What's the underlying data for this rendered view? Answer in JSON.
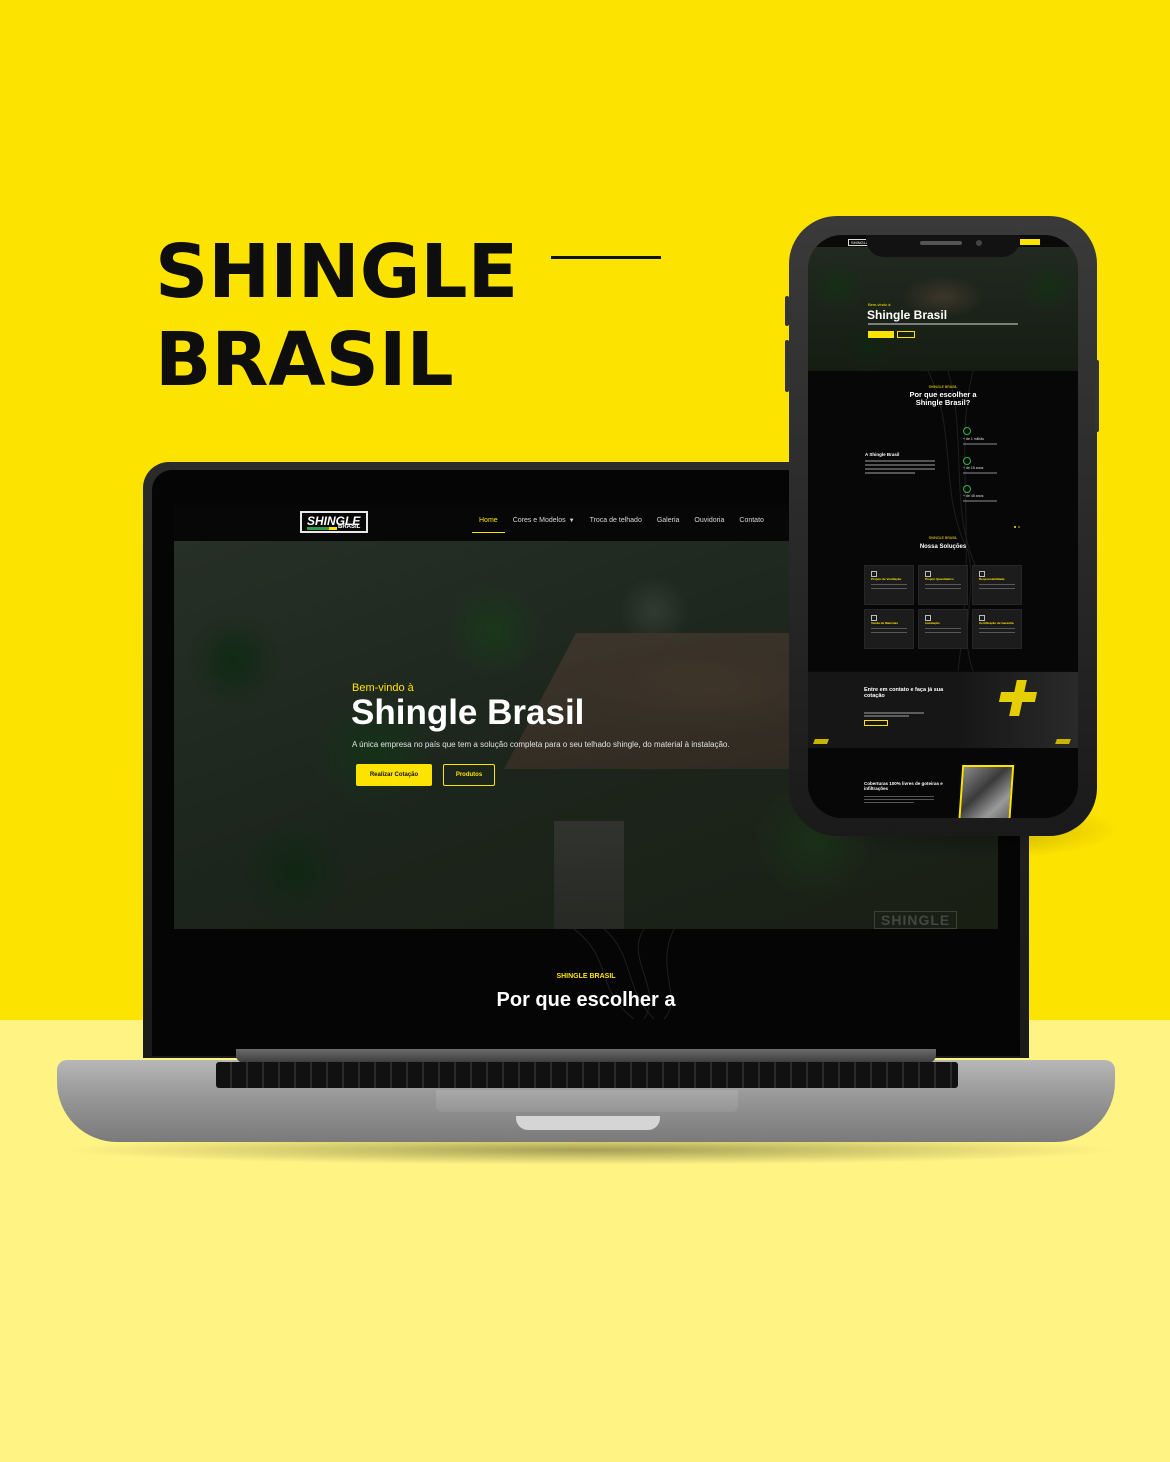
{
  "headline": {
    "line1": "SHINGLE",
    "line2": "BRASIL"
  },
  "colors": {
    "brand_yellow": "#fde300",
    "dark": "#0b0b0b",
    "accent_green": "#2e9a45"
  },
  "desktop": {
    "logo": {
      "main": "SHINGLE",
      "sub": "BRASIL"
    },
    "nav": [
      {
        "label": "Home",
        "active": true
      },
      {
        "label": "Cores e Modelos",
        "dropdown": true
      },
      {
        "label": "Troca de telhado"
      },
      {
        "label": "Galeria"
      },
      {
        "label": "Ouvidoria"
      },
      {
        "label": "Contato"
      }
    ],
    "hero": {
      "pre": "Bem-vindo à",
      "title": "Shingle Brasil",
      "desc": "A única empresa no país que tem a solução completa para o seu telhado shingle, do material à instalação.",
      "primary_btn": "Realizar Cotação",
      "secondary_btn": "Produtos",
      "watermark": "SHINGLE"
    },
    "why": {
      "eyebrow": "SHINGLE BRASIL",
      "title": "Por que escolher a"
    }
  },
  "mobile": {
    "logo": "SHINGLE",
    "nav_btn": "",
    "hero": {
      "pre": "Bem-vindo à",
      "title": "Shingle Brasil"
    },
    "why": {
      "eyebrow": "SHINGLE BRASIL",
      "title_line1": "Por que escolher a",
      "title_line2": "Shingle Brasil?",
      "left_title": "A Shingle Brasil",
      "stats": [
        "+ de 1 milhão",
        "+ de 15 anos",
        "+ de 45 anos"
      ]
    },
    "solutions": {
      "eyebrow": "SHINGLE BRASIL",
      "title": "Nossa Soluções",
      "cards": [
        "Projeto de Ventilação",
        "Projeto Quantitativo",
        "Responsabilidade",
        "Venda de Materiais",
        "Instalação",
        "Certificação de Garantia"
      ]
    },
    "contact": {
      "title": "Entre em contato e faça já sua cotação"
    },
    "roofs": {
      "title": "Coberturas 100% livres de goteiras e infiltrações"
    }
  }
}
